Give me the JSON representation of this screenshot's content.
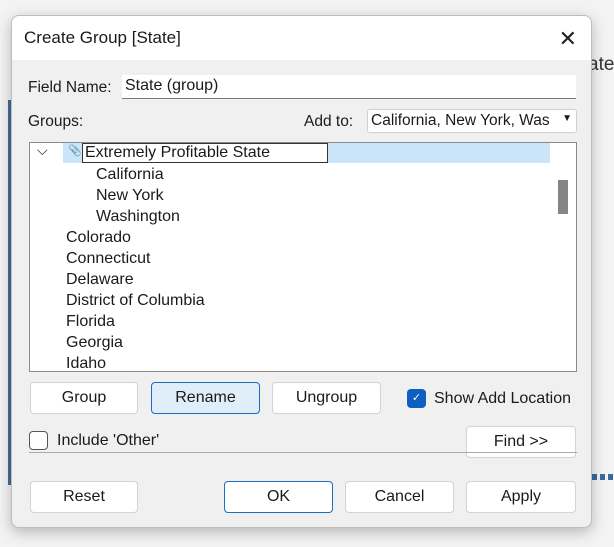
{
  "background": {
    "partial_text": "ate"
  },
  "dialog": {
    "title": "Create Group [State]",
    "field_name_label": "Field Name:",
    "field_name_value": "State (group)",
    "groups_label": "Groups:",
    "add_to_label": "Add to:",
    "add_to_value": "California, New York, Was",
    "tree": {
      "group": {
        "name": "Extremely Profitable State",
        "members": [
          "California",
          "New York",
          "Washington"
        ]
      },
      "items": [
        "Colorado",
        "Connecticut",
        "Delaware",
        "District of Columbia",
        "Florida",
        "Georgia",
        "Idaho"
      ]
    },
    "buttons": {
      "group": "Group",
      "rename": "Rename",
      "ungroup": "Ungroup",
      "find": "Find >>",
      "reset": "Reset",
      "ok": "OK",
      "cancel": "Cancel",
      "apply": "Apply"
    },
    "show_add_location": {
      "label": "Show Add Location",
      "checked": true
    },
    "include_other": {
      "label": "Include 'Other'",
      "checked": false
    },
    "colors": {
      "accent": "#0f5fc0",
      "selection": "#cce4f7"
    }
  }
}
